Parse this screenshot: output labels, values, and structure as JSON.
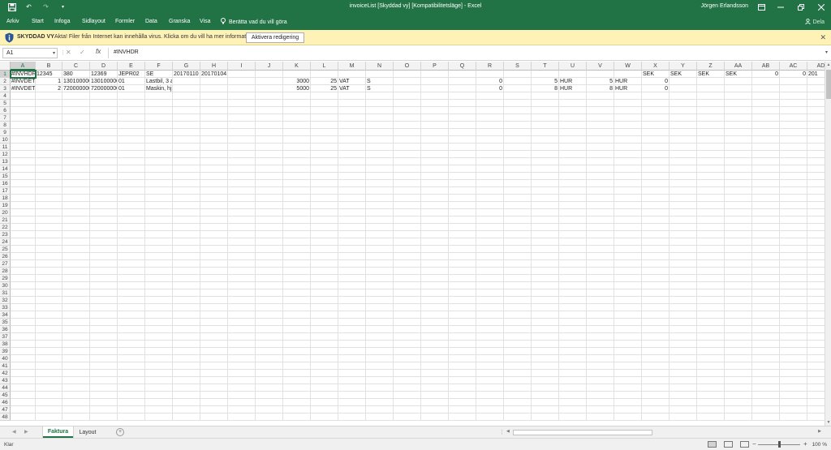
{
  "window": {
    "title": "invoiceList [Skyddad vy] [Kompatibilitetsläge] - Excel",
    "user": "Jörgen Erlandsson",
    "accent": "#217346"
  },
  "ribbon": {
    "tabs": [
      "Arkiv",
      "Start",
      "Infoga",
      "Sidlayout",
      "Formler",
      "Data",
      "Granska",
      "Visa"
    ],
    "tell_me": "Berätta vad du vill göra",
    "share": "Dela"
  },
  "protected_view": {
    "label": "SKYDDAD VY",
    "message": "Akta! Filer från Internet kan innehålla virus. Klicka om du vill ha mer information.",
    "enable_button": "Aktivera redigering",
    "background": "#fff2b7"
  },
  "formula_bar": {
    "name_box": "A1",
    "fx": "fx",
    "formula": "#INVHDR"
  },
  "grid": {
    "columns": [
      "A",
      "B",
      "C",
      "D",
      "E",
      "F",
      "G",
      "H",
      "I",
      "J",
      "K",
      "L",
      "M",
      "N",
      "O",
      "P",
      "Q",
      "R",
      "S",
      "T",
      "U",
      "V",
      "W",
      "X",
      "Y",
      "Z",
      "AA",
      "AB",
      "AC",
      "AD"
    ],
    "row_count": 48,
    "rows": [
      [
        "#INVHDR",
        "12345",
        "380",
        "12369",
        "JEPR02",
        "SE",
        "20170110",
        "20170104",
        "",
        "",
        "",
        "",
        "",
        "",
        "",
        "",
        "",
        "",
        "",
        "",
        "",
        "",
        "",
        "SEK",
        "SEK",
        "SEK",
        "SEK",
        "0",
        "0",
        "201"
      ],
      [
        "#INVDET",
        "1",
        "130100000",
        "130100000",
        "01",
        "Lastbil, 3 a",
        "",
        "",
        "",
        "",
        "3000",
        "25",
        "VAT",
        "S",
        "",
        "",
        "",
        "0",
        "",
        "5",
        "HUR",
        "5",
        "HUR",
        "0",
        "",
        "",
        "",
        "",
        "",
        ""
      ],
      [
        "#INVDET",
        "2",
        "720000000",
        "720000000",
        "01",
        "Maskin, hj",
        "",
        "",
        "",
        "",
        "5000",
        "25",
        "VAT",
        "S",
        "",
        "",
        "",
        "0",
        "",
        "8",
        "HUR",
        "8",
        "HUR",
        "0",
        "",
        "",
        "",
        "",
        "",
        ""
      ]
    ],
    "numeric_align": [
      [
        false,
        false,
        false,
        false,
        false,
        false,
        false,
        false,
        false,
        false,
        false,
        false,
        false,
        false,
        false,
        false,
        false,
        false,
        false,
        false,
        false,
        false,
        false,
        false,
        false,
        false,
        false,
        true,
        true,
        false
      ],
      [
        false,
        true,
        false,
        false,
        false,
        false,
        false,
        false,
        false,
        false,
        true,
        true,
        false,
        false,
        false,
        false,
        false,
        true,
        false,
        true,
        false,
        true,
        false,
        true,
        false,
        false,
        false,
        false,
        false,
        false
      ],
      [
        false,
        true,
        false,
        false,
        false,
        false,
        false,
        false,
        false,
        false,
        true,
        true,
        false,
        false,
        false,
        false,
        false,
        true,
        false,
        true,
        false,
        true,
        false,
        true,
        false,
        false,
        false,
        false,
        false,
        false
      ]
    ],
    "active_cell": "A1"
  },
  "sheets": {
    "tabs": [
      "Faktura",
      "Layout"
    ],
    "active": "Faktura"
  },
  "status": {
    "ready": "Klar",
    "zoom": "100 %"
  }
}
